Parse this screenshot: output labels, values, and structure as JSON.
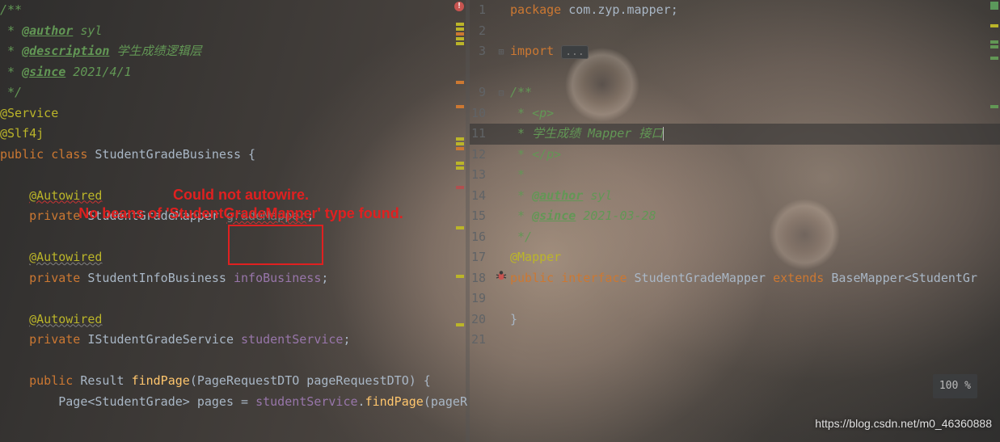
{
  "left": {
    "lines": [
      {
        "type": "doc",
        "text": "/**"
      },
      {
        "type": "doc-author",
        "star": " * ",
        "tag": "@author",
        "rest": " syl"
      },
      {
        "type": "doc-desc",
        "star": " * ",
        "tag": "@description",
        "rest": " 学生成绩逻辑层"
      },
      {
        "type": "doc-since",
        "star": " * ",
        "tag": "@since",
        "rest": " 2021/4/1"
      },
      {
        "type": "doc",
        "text": " */"
      },
      {
        "type": "ann",
        "text": "@Service"
      },
      {
        "type": "ann",
        "text": "@Slf4j"
      },
      {
        "type": "class",
        "kw": "public class ",
        "name": "StudentGradeBusiness",
        "brace": " {"
      },
      {
        "type": "blank",
        "text": ""
      },
      {
        "type": "ann-err",
        "indent": "    ",
        "text": "@Autowired"
      },
      {
        "type": "field-err",
        "indent": "    ",
        "kw": "private ",
        "ftype": "StudentGradeMapper ",
        "fname": "gradeMapper",
        "semi": ";"
      },
      {
        "type": "blank",
        "text": ""
      },
      {
        "type": "ann-i",
        "indent": "    ",
        "text": "@Autowired"
      },
      {
        "type": "field",
        "indent": "    ",
        "kw": "private ",
        "ftype": "StudentInfoBusiness ",
        "fname": "infoBusiness",
        "semi": ";"
      },
      {
        "type": "blank",
        "text": ""
      },
      {
        "type": "ann-i",
        "indent": "    ",
        "text": "@Autowired"
      },
      {
        "type": "field",
        "indent": "    ",
        "kw": "private ",
        "ftype": "IStudentGradeService ",
        "fname": "studentService",
        "semi": ";"
      },
      {
        "type": "blank",
        "text": ""
      },
      {
        "type": "method",
        "indent": "    ",
        "kw": "public ",
        "rtype": "Result ",
        "mname": "findPage",
        "sig": "(PageRequestDTO pageRequestDTO) {"
      },
      {
        "type": "stmt",
        "indent": "        ",
        "pre": "Page<StudentGrade> ",
        "var": "pages",
        "mid": " = ",
        "obj": "studentService",
        "dot": ".",
        "call": "findPage",
        "tail": "(pageR"
      }
    ]
  },
  "error_tooltip": {
    "line1": "Could not autowire.",
    "line2": "No beans of 'StudentGradeMapper' type found."
  },
  "right": {
    "package_kw": "package ",
    "package_name": "com.zyp.mapper",
    "import_kw": "import ",
    "import_fold": "...",
    "doc_open": "/**",
    "p_open": " * <p>",
    "desc_star": " * ",
    "desc_text": "学生成绩 Mapper 接口",
    "p_close": " * </p>",
    "star": " *",
    "author_star": " * ",
    "author_tag": "@author",
    "author_rest": " syl",
    "since_star": " * ",
    "since_tag": "@since",
    "since_rest": " 2021-03-28",
    "doc_close": " */",
    "mapper_ann": "@Mapper",
    "decl_kw1": "public ",
    "decl_kw2": "interface ",
    "decl_name": "StudentGradeMapper ",
    "decl_kw3": "extends ",
    "decl_base": "BaseMapper",
    "decl_gen": "<StudentGr",
    "brace": "}",
    "line_numbers": [
      "1",
      "2",
      "3",
      "",
      "9",
      "10",
      "11",
      "12",
      "13",
      "14",
      "15",
      "16",
      "17",
      "18",
      "19",
      "20",
      "21"
    ]
  },
  "zoom_label": "100 %",
  "watermark": "https://blog.csdn.net/m0_46360888"
}
